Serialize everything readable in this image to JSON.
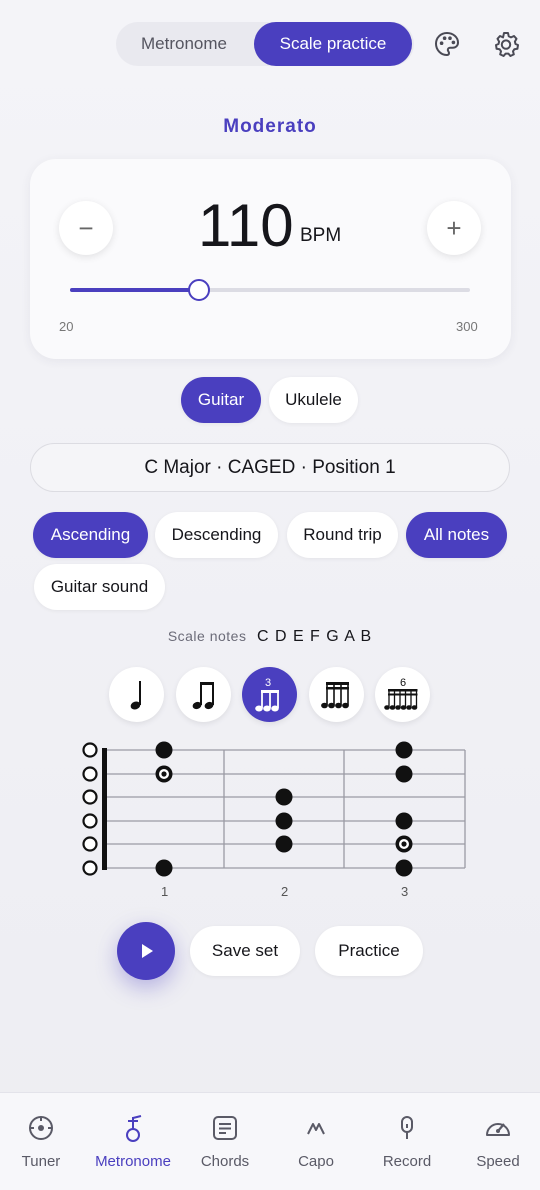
{
  "header": {
    "tabs": [
      {
        "label": "Metronome",
        "active": false
      },
      {
        "label": "Scale practice",
        "active": true
      }
    ],
    "palette_icon": "palette-icon",
    "settings_icon": "gear-icon"
  },
  "tempo": {
    "name": "Moderato",
    "bpm": "110",
    "unit": "BPM",
    "min": "20",
    "max": "300",
    "bpm_value": 110,
    "minus_label": "−",
    "plus_label": "+"
  },
  "instruments": [
    {
      "label": "Guitar",
      "active": true
    },
    {
      "label": "Ukulele",
      "active": false
    }
  ],
  "scale": {
    "selection": "C Major · CAGED · Position 1",
    "notes_label": "Scale notes",
    "notes": "C D E F G A B"
  },
  "options": [
    {
      "label": "Ascending",
      "active": true
    },
    {
      "label": "Descending",
      "active": false
    },
    {
      "label": "Round trip",
      "active": false
    },
    {
      "label": "All notes",
      "active": true
    },
    {
      "label": "Guitar sound",
      "active": false
    }
  ],
  "rhythms": [
    {
      "icon": "quarter-note-icon",
      "active": false
    },
    {
      "icon": "eighth-notes-icon",
      "active": false
    },
    {
      "icon": "triplet-icon",
      "tuplet": "3",
      "active": true
    },
    {
      "icon": "sixteenth-notes-icon",
      "active": false
    },
    {
      "icon": "sextuplet-icon",
      "tuplet": "6",
      "active": false
    }
  ],
  "fretboard": {
    "fret_labels": [
      "1",
      "2",
      "3"
    ]
  },
  "actions": {
    "play_icon": "play-icon",
    "save_label": "Save set",
    "practice_label": "Practice"
  },
  "nav": [
    {
      "label": "Tuner",
      "icon": "tuner-icon",
      "active": false
    },
    {
      "label": "Metronome",
      "icon": "metronome-icon",
      "active": true
    },
    {
      "label": "Chords",
      "icon": "chords-icon",
      "active": false
    },
    {
      "label": "Capo",
      "icon": "capo-icon",
      "active": false
    },
    {
      "label": "Record",
      "icon": "microphone-icon",
      "active": false
    },
    {
      "label": "Speed",
      "icon": "speedometer-icon",
      "active": false
    }
  ],
  "colors": {
    "accent": "#4a3fbf",
    "background": "#f0f0f4",
    "card": "#fafafc"
  }
}
